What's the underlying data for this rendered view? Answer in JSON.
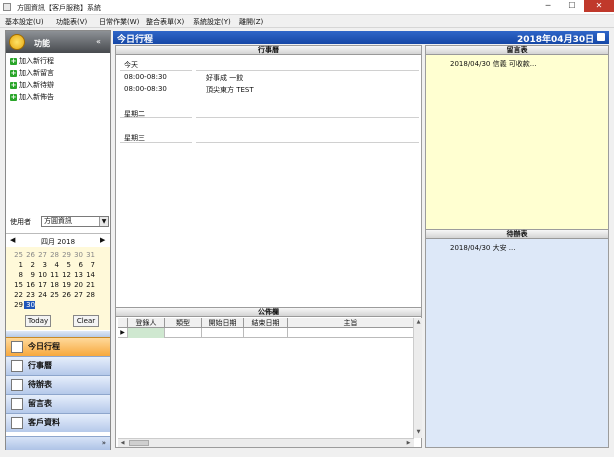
{
  "window": {
    "title": "方圓資訊【客戶服務】系統",
    "buttons": {
      "minimize": "─",
      "maximize": "☐",
      "close": "✕"
    }
  },
  "menu": [
    "基本設定(U)",
    "功能表(V)",
    "日常作業(W)",
    "整合表單(X)",
    "系統設定(Y)",
    "離開(Z)"
  ],
  "function_panel": {
    "title": "功能",
    "collapse": "«",
    "items": [
      "加入新行程",
      "加入新留言",
      "加入新待辦",
      "加入新佈告"
    ]
  },
  "user": {
    "label": "使用者",
    "value": "方圓資訊"
  },
  "calendar": {
    "month": "四月 2018",
    "prev": "◀",
    "next": "▶",
    "weeks": [
      [
        "25",
        "26",
        "27",
        "28",
        "29",
        "30",
        "31"
      ],
      [
        "1",
        "2",
        "3",
        "4",
        "5",
        "6",
        "7"
      ],
      [
        "8",
        "9",
        "10",
        "11",
        "12",
        "13",
        "14"
      ],
      [
        "15",
        "16",
        "17",
        "18",
        "19",
        "20",
        "21"
      ],
      [
        "22",
        "23",
        "24",
        "25",
        "26",
        "27",
        "28"
      ],
      [
        "29",
        "30",
        "",
        "",
        "",
        "",
        ""
      ]
    ],
    "selected": "30",
    "today_label": "Today",
    "clear_label": "Clear"
  },
  "nav": {
    "items": [
      {
        "label": "今日行程",
        "active": true
      },
      {
        "label": "行事曆",
        "active": false
      },
      {
        "label": "待辦表",
        "active": false
      },
      {
        "label": "留言表",
        "active": false
      },
      {
        "label": "客戶資料",
        "active": false
      }
    ],
    "footer": "»"
  },
  "main": {
    "title": "今日行程",
    "date": "2018年04月30日"
  },
  "schedule": {
    "header": "行事曆",
    "days": [
      {
        "label": "今天",
        "entries": [
          {
            "time": "08:00-08:30",
            "text": "好事成 一餃"
          },
          {
            "time": "08:00-08:30",
            "text": "頂尖東方 TEST"
          }
        ]
      },
      {
        "label": "星期二",
        "entries": []
      },
      {
        "label": "星期三",
        "entries": []
      }
    ]
  },
  "notice": {
    "header": "公佈欄",
    "columns": [
      "登錄人",
      "類型",
      "開始日期",
      "結束日期",
      "主旨"
    ],
    "row_marker": "▶"
  },
  "messages": {
    "header": "留言表",
    "items": [
      "2018/04/30 信義 可收款..."
    ]
  },
  "todos": {
    "header": "待辦表",
    "items": [
      "2018/04/30 大安 ..."
    ]
  },
  "colors": {
    "header_blue": "#1f56b8",
    "nav_active": "#f7a83d",
    "message_bg": "#ffffd1",
    "todo_bg": "#dde8f8"
  }
}
